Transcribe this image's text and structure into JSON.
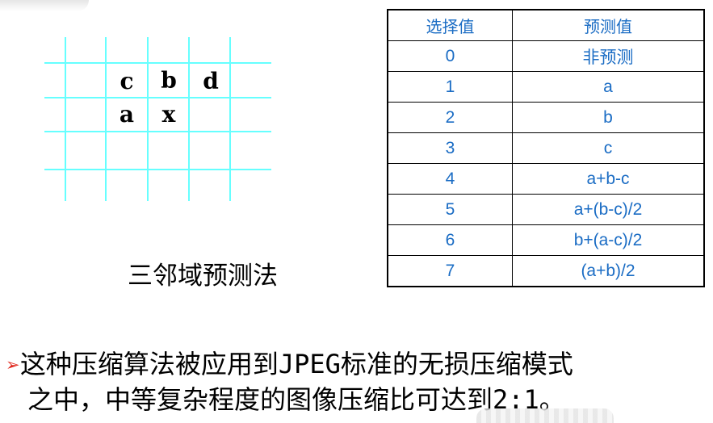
{
  "neighborhood": {
    "letters": {
      "c": "c",
      "b": "b",
      "d": "d",
      "a": "a",
      "x": "x"
    },
    "caption": "三邻域预测法"
  },
  "table": {
    "headers": [
      "选择值",
      "预测值"
    ],
    "rows": [
      [
        "0",
        "非预测"
      ],
      [
        "1",
        "a"
      ],
      [
        "2",
        "b"
      ],
      [
        "3",
        "c"
      ],
      [
        "4",
        "a+b-c"
      ],
      [
        "5",
        "a+(b-c)/2"
      ],
      [
        "6",
        "b+(a-c)/2"
      ],
      [
        "7",
        "(a+b)/2"
      ]
    ]
  },
  "bullet": {
    "marker": "➢",
    "line1": "这种压缩算法被应用到JPEG标准的无损压缩模式",
    "line2": "之中，中等复杂程度的图像压缩比可达到2:1。"
  },
  "colors": {
    "grid": "#66ffff",
    "table_text": "#1a6cc4",
    "bullet_marker": "#e0261b"
  }
}
